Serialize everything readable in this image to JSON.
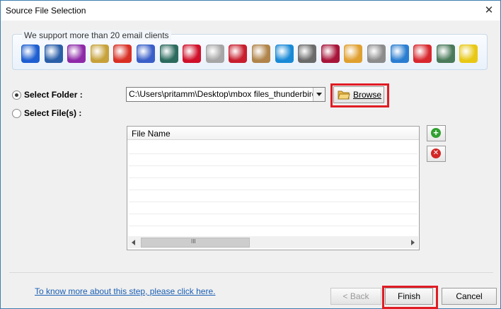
{
  "window": {
    "title": "Source File Selection",
    "close_glyph": "✕"
  },
  "support": {
    "label": "We support more than 20 email clients",
    "clients": [
      {
        "name": "mail-icon",
        "color": "#1e5fd1"
      },
      {
        "name": "thunderbird-icon",
        "color": "#2a5fa8"
      },
      {
        "name": "entourage-icon",
        "color": "#8e2aa8"
      },
      {
        "name": "eudora-icon",
        "color": "#c7a23a"
      },
      {
        "name": "gmail-icon",
        "color": "#d93025"
      },
      {
        "name": "postbox-icon",
        "color": "#3a5fc8"
      },
      {
        "name": "seamonkey-icon",
        "color": "#2c6b5e"
      },
      {
        "name": "opera-icon",
        "color": "#d0102a"
      },
      {
        "name": "windows-mail-icon",
        "color": "#a6a6a6"
      },
      {
        "name": "mailbird-icon",
        "color": "#c81e2e"
      },
      {
        "name": "sylpheed-icon",
        "color": "#b0844a"
      },
      {
        "name": "mailcopa-icon",
        "color": "#1a8ad6"
      },
      {
        "name": "mutt-icon",
        "color": "#6b6b6b"
      },
      {
        "name": "pocomail-icon",
        "color": "#a8153a"
      },
      {
        "name": "gyazmail-icon",
        "color": "#e0a030"
      },
      {
        "name": "gnu-icon",
        "color": "#8c8c8c"
      },
      {
        "name": "spicebird-icon",
        "color": "#2a7ed1"
      },
      {
        "name": "envelope-icon",
        "color": "#d8282e"
      },
      {
        "name": "evolution-icon",
        "color": "#4a7a5a"
      },
      {
        "name": "the-bat-icon",
        "color": "#e8c814"
      }
    ]
  },
  "source": {
    "folder_label": "Select Folder :",
    "file_label": "Select File(s) :",
    "folder_path": "C:\\Users\\pritamm\\Desktop\\mbox files_thunderbird",
    "browse_label": "Browse",
    "accent_red": "#e01c24"
  },
  "file_list": {
    "header": "File Name",
    "rows": [],
    "scroll_grip": "III"
  },
  "side_buttons": {
    "add_glyph": "+",
    "remove_glyph": "✕"
  },
  "footer": {
    "help_link": "To know more about this step, please click here.",
    "back_label": "< Back",
    "finish_label": "Finish",
    "cancel_label": "Cancel"
  }
}
